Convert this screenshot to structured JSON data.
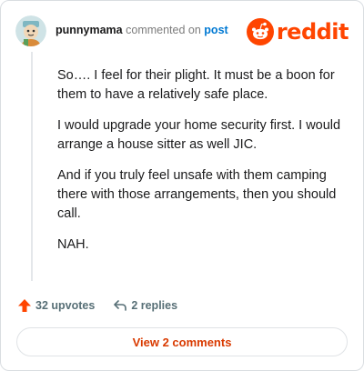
{
  "comment": {
    "username": "punnymama",
    "commented_on": "commented on",
    "post_link": "post",
    "paragraphs": [
      "So…. I feel for their plight. It must be a boon for them to have a relatively safe place.",
      "I would upgrade your home security first. I would arrange a house sitter as well JIC.",
      "And if you truly feel unsafe with them camping there with those arrangements, then you should call.",
      "NAH."
    ]
  },
  "brand": {
    "logo_text": "reddit",
    "color": "#ff4500"
  },
  "actions": {
    "upvotes": "32 upvotes",
    "replies": "2 replies"
  },
  "footer": {
    "view_comments": "View 2 comments"
  },
  "icons": [
    "avatar",
    "reddit-snoo-icon",
    "upvote-arrow-icon",
    "reply-arrow-icon"
  ]
}
